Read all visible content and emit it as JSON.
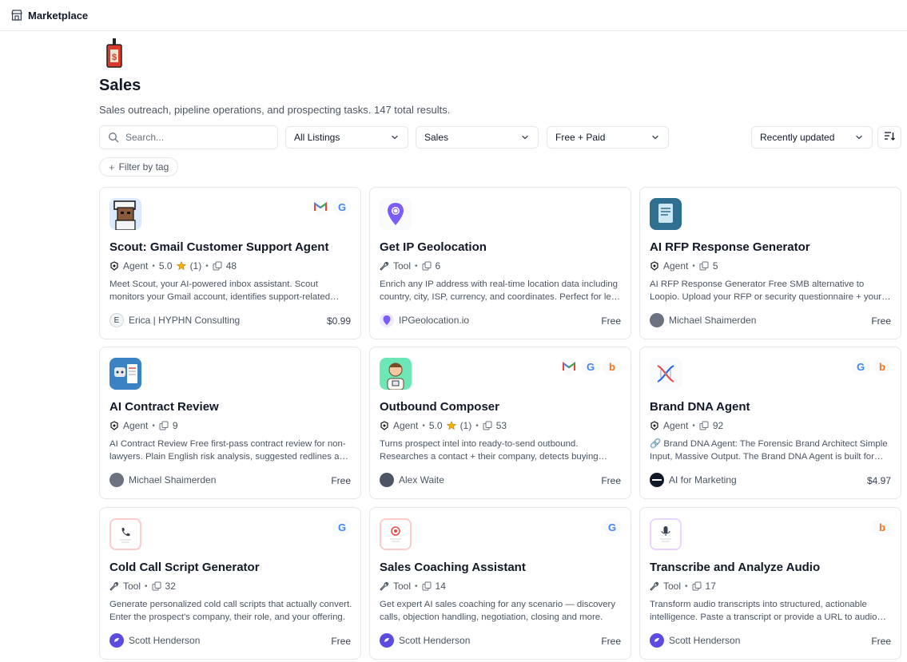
{
  "app": {
    "title": "Marketplace"
  },
  "page": {
    "title": "Sales",
    "description": "Sales outreach, pipeline operations, and prospecting tasks. 147 total results."
  },
  "filters": {
    "search_placeholder": "Search...",
    "listings": "All Listings",
    "category": "Sales",
    "pricing": "Free + Paid",
    "sort": "Recently updated",
    "tag_button": "Filter by tag"
  },
  "cards": [
    {
      "title": "Scout: Gmail Customer Support Agent",
      "type": "Agent",
      "rating": "5.0",
      "reviews": "(1)",
      "copies": "48",
      "description": "Meet Scout, your AI-powered inbox assistant. Scout monitors your Gmail account, identifies support-related emails and drafts helpful replies.",
      "author": "Erica | HYPHN Consulting",
      "author_initial": "E",
      "price": "$0.99",
      "providers": [
        "gmail-icon",
        "google-icon"
      ]
    },
    {
      "title": "Get IP Geolocation",
      "type": "Tool",
      "copies": "6",
      "description": "Enrich any IP address with real-time location data including country, city, ISP, currency, and coordinates. Perfect for lead enrichment.",
      "author": "IPGeolocation.io",
      "price": "Free",
      "providers": []
    },
    {
      "title": "AI RFP Response Generator",
      "type": "Agent",
      "copies": "5",
      "description": "AI RFP Response Generator Free SMB alternative to Loopio. Upload your RFP or security questionnaire + your knowledge base.",
      "author": "Michael Shaimerden",
      "price": "Free",
      "providers": []
    },
    {
      "title": "AI Contract Review",
      "type": "Agent",
      "copies": "9",
      "description": "AI Contract Review Free first-pass contract review for non-lawyers. Plain English risk analysis, suggested redlines and negotiation tips.",
      "author": "Michael Shaimerden",
      "price": "Free",
      "providers": []
    },
    {
      "title": "Outbound Composer",
      "type": "Agent",
      "rating": "5.0",
      "reviews": "(1)",
      "copies": "53",
      "description": "Turns prospect intel into ready-to-send outbound. Researches a contact + their company, detects buying signals and writes the email.",
      "author": "Alex Waite",
      "price": "Free",
      "providers": [
        "gmail-icon",
        "google-icon",
        "bing-icon"
      ]
    },
    {
      "title": "Brand DNA Agent",
      "type": "Agent",
      "copies": "92",
      "description": "🔗 Brand DNA Agent: The Forensic Brand Architect Simple Input, Massive Output. The Brand DNA Agent is built for marketers.",
      "author": "AI for Marketing",
      "price": "$4.97",
      "providers": [
        "google-icon",
        "bing-icon"
      ]
    },
    {
      "title": "Cold Call Script Generator",
      "type": "Tool",
      "copies": "32",
      "description": "Generate personalized cold call scripts that actually convert. Enter the prospect's company, their role, and your offering.",
      "author": "Scott Henderson",
      "price": "Free",
      "providers": [
        "google-icon"
      ]
    },
    {
      "title": "Sales Coaching Assistant",
      "type": "Tool",
      "copies": "14",
      "description": "Get expert AI sales coaching for any scenario — discovery calls, objection handling, negotiation, closing and more.",
      "author": "Scott Henderson",
      "price": "Free",
      "providers": [
        "google-icon"
      ]
    },
    {
      "title": "Transcribe and Analyze Audio",
      "type": "Tool",
      "copies": "17",
      "description": "Transform audio transcripts into structured, actionable intelligence. Paste a transcript or provide a URL to audio files.",
      "author": "Scott Henderson",
      "price": "Free",
      "providers": [
        "bing-icon"
      ]
    }
  ],
  "colors": {
    "google_blue": "#4285F4",
    "gmail_red": "#EA4335",
    "bing_orange": "#F97316",
    "star": "#F5B301",
    "accent_purple": "#5B4BE1"
  }
}
